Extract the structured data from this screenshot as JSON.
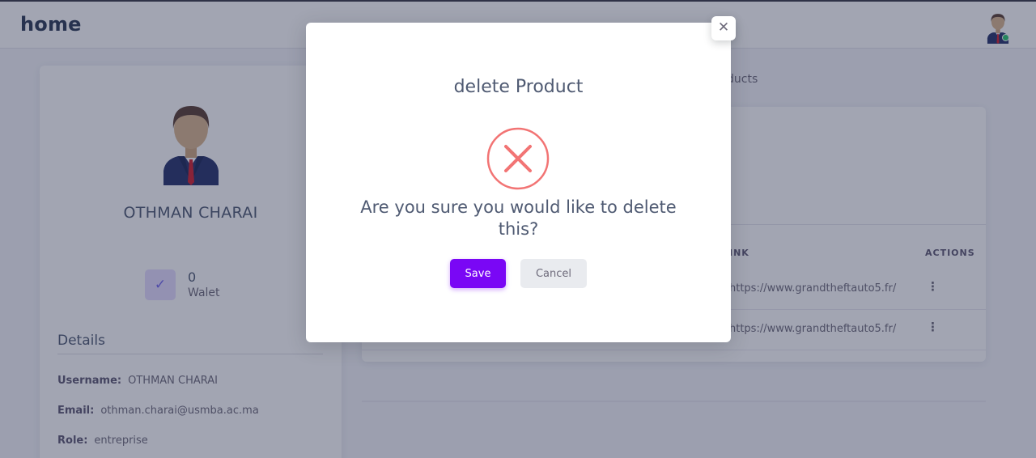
{
  "app": {
    "title": "home"
  },
  "profile": {
    "name": "OTHMAN CHARAI",
    "walet": {
      "count": "0",
      "label": "Walet",
      "icon": "check-icon"
    },
    "details": {
      "title": "Details",
      "rows": [
        {
          "key": "Username:",
          "value": "OTHMAN CHARAI"
        },
        {
          "key": "Email:",
          "value": "othman.charai@usmba.ac.ma"
        },
        {
          "key": "Role:",
          "value": "entreprise"
        }
      ]
    }
  },
  "breadcrumb": {
    "tail": "ducts"
  },
  "table": {
    "headers": {
      "link": "INK",
      "actions": "ACTIONS"
    },
    "rows": [
      {
        "link": "https://www.grandtheftauto5.fr/"
      },
      {
        "link": "https://www.grandtheftauto5.fr/"
      }
    ]
  },
  "modal": {
    "title": "delete Product",
    "question": "Are you sure you would like to delete this?",
    "save_label": "Save",
    "cancel_label": "Cancel",
    "close_glyph": "✕",
    "icon": "error-x-icon"
  },
  "colors": {
    "primary": "#7a07f5",
    "danger": "#ea5455",
    "online": "#28c76f"
  }
}
